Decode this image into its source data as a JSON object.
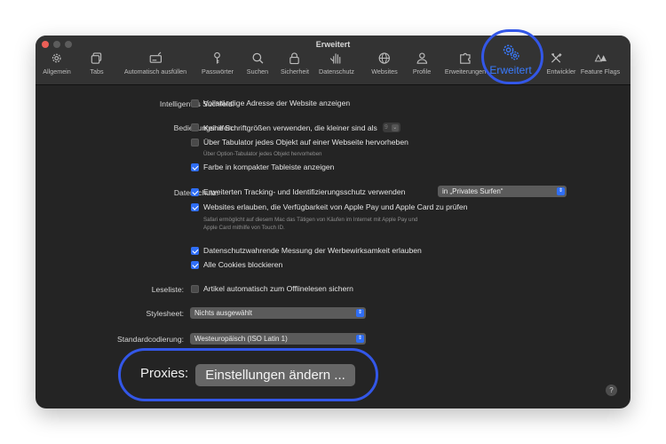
{
  "window": {
    "title": "Erweitert"
  },
  "tabs": [
    {
      "label": "Allgemein",
      "icon": "gear-icon"
    },
    {
      "label": "Tabs",
      "icon": "tabs-icon"
    },
    {
      "label": "Automatisch ausfüllen",
      "icon": "autofill-icon"
    },
    {
      "label": "Passwörter",
      "icon": "key-icon"
    },
    {
      "label": "Suchen",
      "icon": "search-icon"
    },
    {
      "label": "Sicherheit",
      "icon": "lock-icon"
    },
    {
      "label": "Datenschutz",
      "icon": "hand-icon"
    },
    {
      "label": "Websites",
      "icon": "globe-icon"
    },
    {
      "label": "Profile",
      "icon": "person-icon"
    },
    {
      "label": "Erweiterungen",
      "icon": "puzzle-icon"
    },
    {
      "label": "Erweitert",
      "icon": "gears-icon",
      "active": true
    },
    {
      "label": "Entwickler",
      "icon": "tools-icon"
    },
    {
      "label": "Feature Flags",
      "icon": "flags-icon"
    }
  ],
  "settings": {
    "smart_search": {
      "label": "Intelligentes Suchfeld:",
      "option": "Vollständige Adresse der Website anzeigen"
    },
    "accessibility": {
      "label": "Bedienungshilfen:",
      "font_size_option": "Keine Schriftgrößen verwenden, die kleiner sind als",
      "font_size_value": "9",
      "tab_option": "Über Tabulator jedes Objekt auf einer Webseite hervorheben",
      "tab_note": "Über Option-Tabulator jedes Objekt hervorheben",
      "color_option": "Farbe in kompakter Tableiste anzeigen"
    },
    "privacy": {
      "label": "Datenschutz:",
      "tracking_option": "Erweiterten Tracking- und Identifizierungsschutz verwenden",
      "tracking_select": "in „Privates Surfen“",
      "applepay_option": "Websites erlauben, die Verfügbarkeit von Apple Pay und Apple Card zu prüfen",
      "applepay_note_line1": "Safari ermöglicht auf diesem Mac das Tätigen von Käufen im Internet mit Apple Pay und",
      "applepay_note_line2": "Apple Card mithilfe von Touch ID.",
      "ad_measure_option": "Datenschutzwahrende Messung der Werbewirksamkeit erlauben",
      "cookies_option": "Alle Cookies blockieren"
    },
    "reading_list": {
      "label": "Leseliste:",
      "option": "Artikel automatisch zum Offlinelesen sichern"
    },
    "stylesheet": {
      "label": "Stylesheet:",
      "value": "Nichts ausgewählt"
    },
    "encoding": {
      "label": "Standardcodierung:",
      "value": "Westeuropäisch (ISO Latin 1)"
    },
    "proxies": {
      "label": "Proxies:",
      "button": "Einstellungen ändern ..."
    }
  },
  "help": "?",
  "colors": {
    "accent": "#2f6ef6",
    "highlight": "#3357e8",
    "window_bg": "#242424"
  }
}
